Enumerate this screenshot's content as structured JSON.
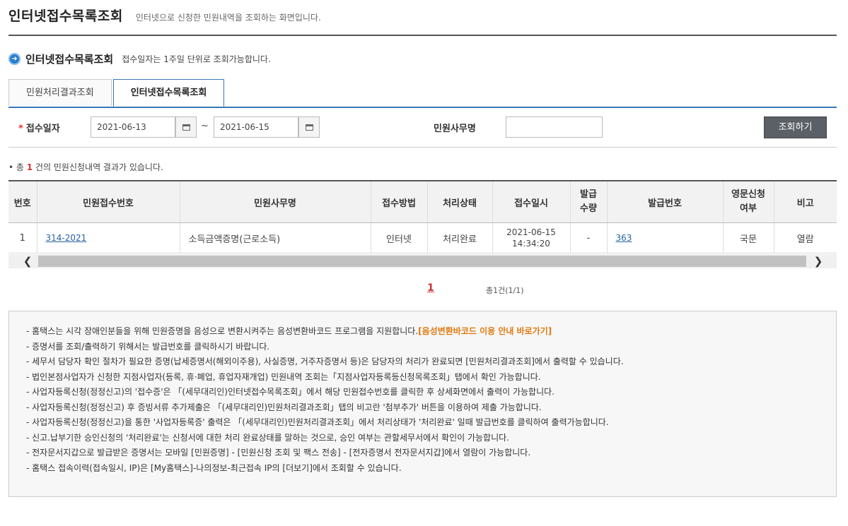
{
  "header": {
    "title": "인터넷접수목록조회",
    "description": "인터넷으로 신청한 민원내역을 조회하는 화면입니다."
  },
  "section": {
    "icon": "arrow-circle-icon",
    "title": "인터넷접수목록조회",
    "description": "접수일자는 1주일 단위로 조회가능합니다."
  },
  "tabs": [
    {
      "label": "민원처리결과조회",
      "active": false
    },
    {
      "label": "인터넷접수목록조회",
      "active": true
    }
  ],
  "search": {
    "date_label": "접수일자",
    "required_mark": "*",
    "start_date": "2021-06-13",
    "separator": "~",
    "end_date": "2021-06-15",
    "office_label": "민원사무명",
    "office_value": "",
    "button_label": "조회하기"
  },
  "result": {
    "prefix": "총",
    "count": "1",
    "suffix": "건의 민원신청내역 결과가 있습니다."
  },
  "table": {
    "headers": [
      "번호",
      "민원접수번호",
      "민원사무명",
      "접수방법",
      "처리상태",
      "접수일시",
      "발급\n수량",
      "발급번호",
      "영문신청\n여부",
      "비고"
    ],
    "rows": [
      {
        "no": "1",
        "receipt_no": "314-2021",
        "office_name": "소득금액증명(근로소득)",
        "method": "인터넷",
        "status": "처리완료",
        "received_date": "2021-06-15",
        "received_time": "14:34:20",
        "issue_qty": "-",
        "issue_no": "363",
        "english": "국문",
        "remark": "열람"
      }
    ]
  },
  "pager": {
    "current": "1",
    "total": "총1건(1/1)"
  },
  "notice": {
    "lines": [
      "- 홈택스는 시각 장애인분들을 위해 민원증명을 음성으로 변환시켜주는 음성변환바코드 프로그램을 지원합니다.",
      "- 증명서를 조회/출력하기 위해서는 발급번호를 클릭하시기 바랍니다.",
      "- 세무서 담당자 확인 절차가 필요한 증명(납세증명서(해외이주용), 사실증명, 거주자증명서 등)은 담당자의 처리가 완료되면 [민원처리결과조회]에서 출력할 수 있습니다.",
      "- 법인본점사업자가 신청한 지점사업자(등록, 휴·폐업, 휴업자재개업) 민원내역 조회는「지점사업자등록등신청목록조회」탭에서 확인 가능합니다.",
      "- 사업자등록신청(정정신고)의 '접수증'은 「(세무대리인)인터넷접수목록조회」에서 해당 민원접수번호를 클릭한 후 상세화면에서 출력이 가능합니다.",
      "- 사업자등록신청(정정신고) 후 증빙서류 추가제출은 「(세무대리인)민원처리결과조회」탭의 비고란 '첨부추가' 버튼을 이용하여 제출 가능합니다.",
      "- 사업자등록신청(정정신고)을 통한 '사업자등록증' 출력은 「(세무대리인)민원처리결과조회」에서 처리상태가 '처리완료' 일때 발급번호를 클릭하여 출력가능합니다.",
      "- 신고.납부기한 승인신청의 '처리완료'는 신청서에 대한 처리 완료상태를 말하는 것으로, 승인 여부는 관할세무서에서 확인이 가능합니다.",
      "- 전자문서지갑으로 발급받은 증명서는 모바일 [민원증명] - [민원신청 조회 및 팩스 전송] - [전자증명서 전자문서지갑]에서 열람이 가능합니다.",
      "- 홈택스 접속이력(접속일시, IP)은 [My홈택스]-나의정보-최근접속 IP의 [더보기]에서 조회할 수 있습니다."
    ],
    "link_label": "[음성변환바코드 이용 안내 바로가기]"
  },
  "colors": {
    "accent": "#3a78b8",
    "highlight": "#e07a10",
    "count": "#dd3333"
  }
}
